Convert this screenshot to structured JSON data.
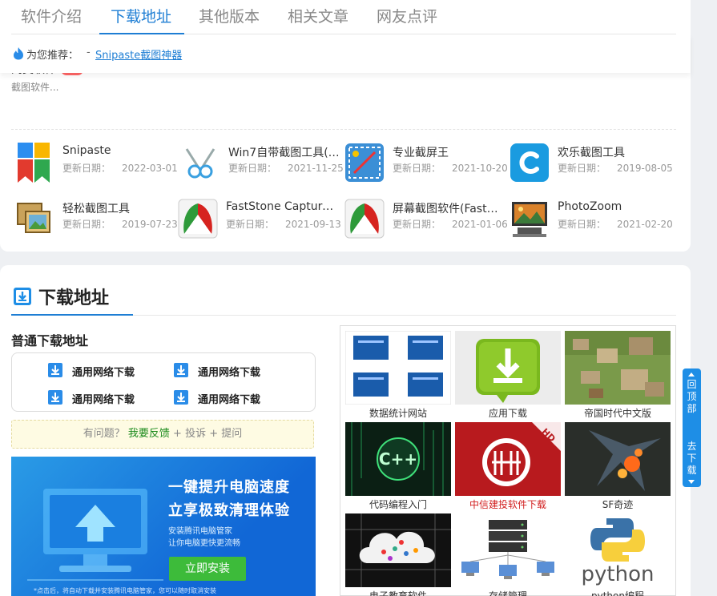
{
  "tabs": [
    {
      "label": "软件介绍"
    },
    {
      "label": "下载地址"
    },
    {
      "label": "其他版本"
    },
    {
      "label": "相关文章"
    },
    {
      "label": "网友点评"
    }
  ],
  "recommend": {
    "label": "为您推荐：",
    "sep": "-",
    "link": "Snipaste截图神器"
  },
  "peek": {
    "title": "同类软件",
    "desc": "截图软件..."
  },
  "software": [
    {
      "name": "Snipaste",
      "upd_label": "更新日期：",
      "date": "2022-03-01",
      "icon": "snipaste-icon"
    },
    {
      "name": "Win7自带截图工具(S...",
      "upd_label": "更新日期：",
      "date": "2021-11-25",
      "icon": "scissors-icon"
    },
    {
      "name": "专业截屏王",
      "upd_label": "更新日期：",
      "date": "2021-10-20",
      "icon": "screenshot-pro-icon"
    },
    {
      "name": "欢乐截图工具",
      "upd_label": "更新日期：",
      "date": "2019-08-05",
      "icon": "c-logo-icon"
    },
    {
      "name": "轻松截图工具",
      "upd_label": "更新日期：",
      "date": "2019-07-23",
      "icon": "pictures-icon"
    },
    {
      "name": "FastStone Capture...",
      "upd_label": "更新日期：",
      "date": "2021-09-13",
      "icon": "faststone-icon"
    },
    {
      "name": "屏幕截图软件(FastSt...",
      "upd_label": "更新日期：",
      "date": "2021-01-06",
      "icon": "faststone-icon"
    },
    {
      "name": "PhotoZoom",
      "upd_label": "更新日期：",
      "date": "2021-02-20",
      "icon": "photozoom-icon"
    }
  ],
  "download": {
    "title": "下载地址",
    "normal_title": "普通下载地址",
    "buttons": [
      "通用网络下载",
      "通用网络下载",
      "通用网络下载",
      "通用网络下载"
    ]
  },
  "feedback": {
    "prefix": "有问题？",
    "link": "我要反馈",
    "plus1": " + ",
    "complain": "投诉",
    "plus2": " + ",
    "ask": "提问"
  },
  "ad": {
    "headline1": "一键提升电脑速度",
    "headline2": "立享极致清理体验",
    "sub1": "安装腾讯电脑管家",
    "sub2": "让你电脑更快更流畅",
    "button": "立即安装",
    "note": "*点击后，将自动下载并安装腾讯电脑管家，您可以随时取消安装"
  },
  "grid": [
    {
      "label": "数据统计网站",
      "thumb": "data-stats-thumb"
    },
    {
      "label": "应用下载",
      "thumb": "app-download-thumb"
    },
    {
      "label": "帝国时代中文版",
      "thumb": "age-of-empires-thumb"
    },
    {
      "label": "代码编程入门",
      "thumb": "cpp-code-thumb"
    },
    {
      "label": "中信建投软件下载",
      "thumb": "citic-thumb",
      "highlight": true
    },
    {
      "label": "SF奇迹",
      "thumb": "sf-game-thumb"
    },
    {
      "label": "电子教育软件",
      "thumb": "edu-cloud-thumb"
    },
    {
      "label": "存储管理",
      "thumb": "storage-thumb"
    },
    {
      "label": "python编程",
      "thumb": "python-thumb"
    }
  ],
  "side": {
    "top": "回顶部",
    "down": "去下载"
  },
  "colors": {
    "accent": "#1e7ed4",
    "green": "#3dbb3a",
    "red": "#d21f1f"
  }
}
